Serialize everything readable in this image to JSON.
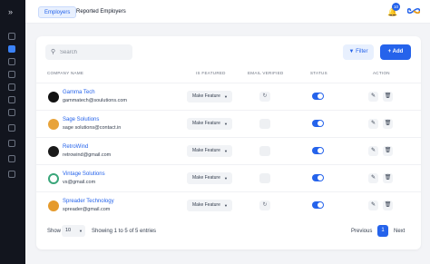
{
  "sidebar": {
    "toggle_icon": "double-chevron-right-icon",
    "items": [
      {
        "icon": "dashboard-icon"
      },
      {
        "icon": "users-icon",
        "active": true
      },
      {
        "icon": "briefcase-icon"
      },
      {
        "icon": "document-icon"
      },
      {
        "icon": "chat-icon"
      },
      {
        "icon": "settings-icon"
      },
      {
        "icon": "chart-icon"
      },
      {
        "icon": "bookmark-icon"
      },
      {
        "icon": "calendar-icon"
      },
      {
        "icon": "list-icon"
      },
      {
        "icon": "help-icon"
      }
    ]
  },
  "topbar": {
    "tabs": [
      {
        "label": "Employers",
        "active": true
      },
      {
        "label": "Reported Employers",
        "active": false
      }
    ],
    "notification_count": "10",
    "logo_icon": "infinity-logo-icon"
  },
  "toolbar": {
    "search_placeholder": "Search",
    "filter_label": "Filter",
    "add_label": "Add"
  },
  "table": {
    "headers": {
      "company": "COMPANY NAME",
      "featured": "IS FEATURED",
      "verified": "EMAIL VERIFIED",
      "status": "STATUS",
      "action": "ACTION"
    },
    "rows": [
      {
        "name": "Gamma Tech",
        "email": "gammatech@soulutions.com",
        "feature_label": "Make Feature",
        "email_verified": true,
        "status": true,
        "avatar_color": "#111111"
      },
      {
        "name": "Sage Solutions",
        "email": "sage solutions@contact.in",
        "feature_label": "Make Feature",
        "email_verified": false,
        "status": true,
        "avatar_color": "#e8a33a"
      },
      {
        "name": "RetroWind",
        "email": "retrowind@gmail.com",
        "feature_label": "Make Feature",
        "email_verified": false,
        "status": true,
        "avatar_color": "#1a1a1a"
      },
      {
        "name": "Vintage Solutions",
        "email": "vs@gmail.com",
        "feature_label": "Make Feature",
        "email_verified": false,
        "status": true,
        "avatar_color": "#3aa67a"
      },
      {
        "name": "Spreader Technology",
        "email": "spreader@gmail.com",
        "feature_label": "Make Feature",
        "email_verified": true,
        "status": true,
        "avatar_color": "#e59a2c"
      }
    ]
  },
  "footer": {
    "show_label": "Show",
    "page_size": "10",
    "entries_text": "Showing 1 to 5 of 5 entries",
    "previous_label": "Previous",
    "current_page": "1",
    "next_label": "Next"
  },
  "colors": {
    "accent": "#2563eb",
    "sidebar_bg": "#12151e"
  }
}
